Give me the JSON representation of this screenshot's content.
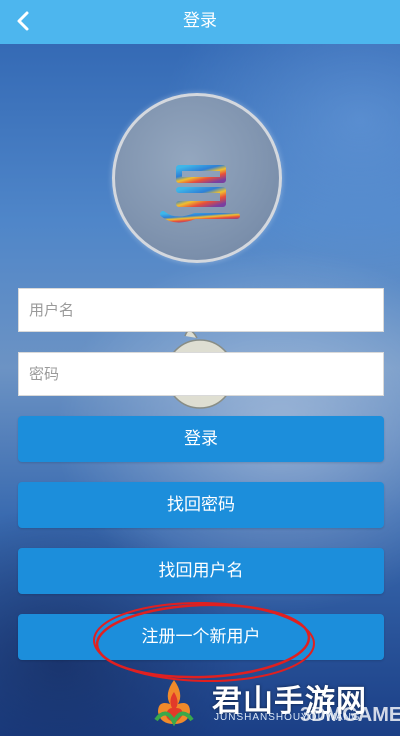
{
  "header": {
    "title": "登录",
    "back_icon": "chevron-left-icon"
  },
  "form": {
    "username_placeholder": "用户名",
    "password_placeholder": "密码"
  },
  "buttons": {
    "login": "登录",
    "find_password": "找回密码",
    "find_username": "找回用户名",
    "register": "注册一个新用户"
  },
  "watermark": {
    "brand": "君山手游网",
    "subtitle": "JUNSHANSHOUYOUWANG",
    "partner": "3DMGAME"
  },
  "colors": {
    "topbar": "#4db6ee",
    "button": "#1c8edb",
    "annotation": "#e02020"
  }
}
